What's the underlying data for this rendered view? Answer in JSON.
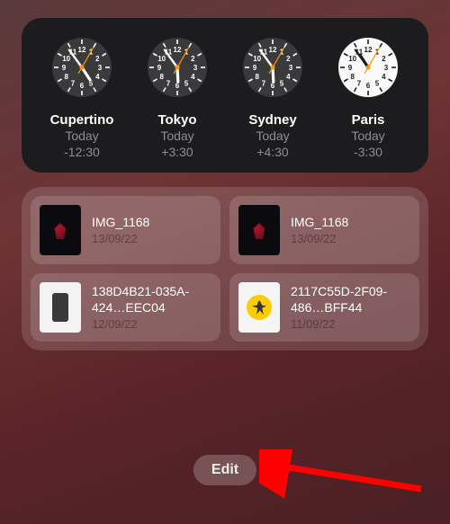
{
  "world_clock": {
    "items": [
      {
        "city": "Cupertino",
        "day": "Today",
        "offset": "-12:30",
        "face": "dark",
        "hour": 4,
        "minute": 54
      },
      {
        "city": "Tokyo",
        "day": "Today",
        "offset": "+3:30",
        "face": "dark",
        "hour": 5,
        "minute": 54
      },
      {
        "city": "Sydney",
        "day": "Today",
        "offset": "+4:30",
        "face": "dark",
        "hour": 5,
        "minute": 54
      },
      {
        "city": "Paris",
        "day": "Today",
        "offset": "-3:30",
        "face": "light",
        "hour": 10,
        "minute": 54
      }
    ]
  },
  "files": {
    "items": [
      {
        "name": "IMG_1168",
        "date": "13/09/22",
        "thumb": "dark"
      },
      {
        "name": "IMG_1168",
        "date": "13/09/22",
        "thumb": "dark"
      },
      {
        "name": "138D4B21-035A-424…EEC04",
        "date": "12/09/22",
        "thumb": "dev"
      },
      {
        "name": "2117C55D-2F09-486…BFF44",
        "date": "11/09/22",
        "thumb": "run"
      }
    ]
  },
  "edit_button": {
    "label": "Edit"
  }
}
